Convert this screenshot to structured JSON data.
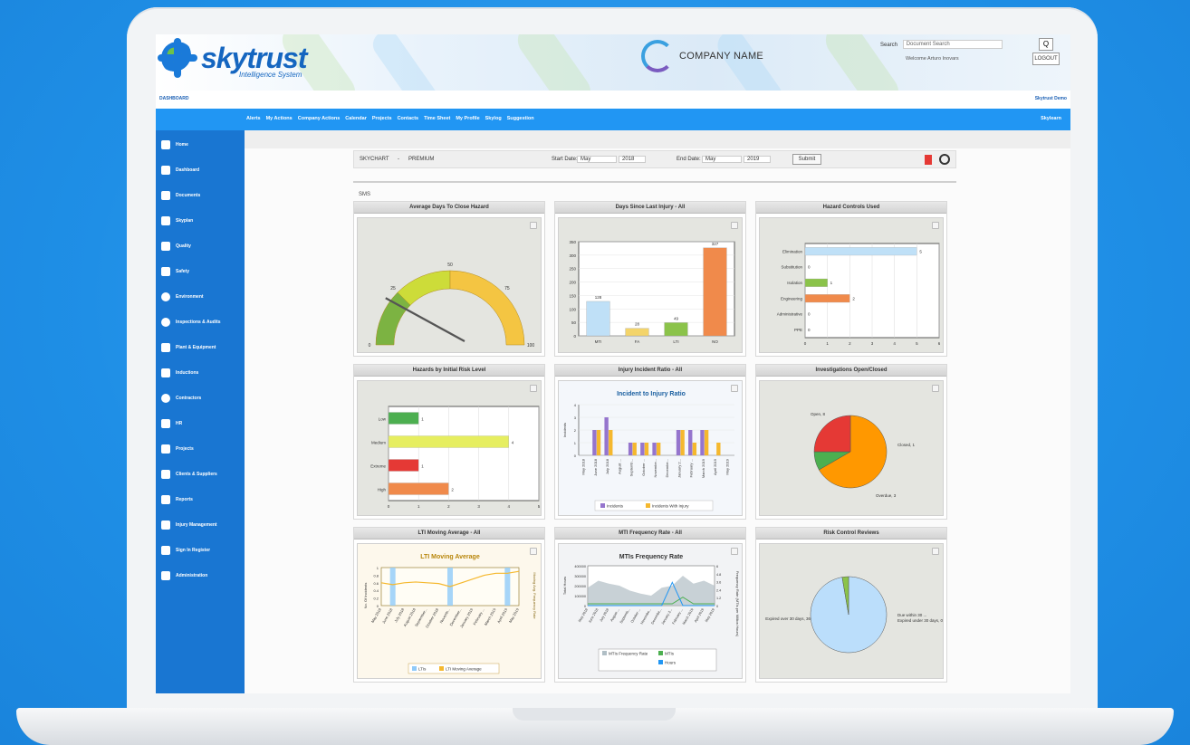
{
  "header": {
    "logo_text": "skytrust",
    "logo_subtitle": "Intelligence System",
    "company_name": "COMPANY NAME",
    "search_label": "Search",
    "search_placeholder": "Document Search",
    "welcome": "Welcome Arturo Inovars",
    "search_button": "Q",
    "logout": "LOGOUT"
  },
  "breadcrumb": {
    "left": "DASHBOARD",
    "right": "Skytrust Demo"
  },
  "nav": {
    "items": [
      "Alerts",
      "My Actions",
      "Company Actions",
      "Calendar",
      "Projects",
      "Contacts",
      "Time Sheet",
      "My Profile",
      "Skylog",
      "Suggestion"
    ],
    "right": "Skylearn"
  },
  "sidebar": {
    "items": [
      "Home",
      "Dashboard",
      "Documents",
      "Skyplan",
      "Quality",
      "Safety",
      "Environment",
      "Inspections & Audits",
      "Plant & Equipment",
      "Inductions",
      "Contractors",
      "HR",
      "Projects",
      "Clients & Suppliers",
      "Reports",
      "Injury Management",
      "Sign In Register",
      "Administration"
    ]
  },
  "toolbar": {
    "skychart": "SKYCHART",
    "sep": "-",
    "plan": "PREMIUM",
    "start_label": "Start Date:",
    "start_month": "May",
    "start_year": "2018",
    "end_label": "End Date:",
    "end_month": "May",
    "end_year": "2019",
    "submit": "Submit"
  },
  "section_label": "SMS",
  "colors": {
    "blue": "#2196f3",
    "sidebar": "#1976d2",
    "panel_bg": "#e4e5e0"
  },
  "chart_data": [
    {
      "id": "gauge",
      "title": "Average Days To Close Hazard",
      "type": "gauge",
      "min": 0,
      "max": 100,
      "ticks": [
        0,
        25,
        50,
        75,
        100
      ],
      "value": 20
    },
    {
      "id": "days-injury",
      "title": "Days Since Last Injury - All",
      "type": "bar",
      "categories": [
        "MTI",
        "FA",
        "LTI",
        "NO"
      ],
      "values": [
        128,
        28,
        49,
        327
      ],
      "colors": [
        "#bfe0f7",
        "#f3d46a",
        "#8bc34a",
        "#f08a4b"
      ],
      "ylim": [
        0,
        350
      ],
      "yticks": [
        0,
        50,
        100,
        150,
        200,
        250,
        300,
        350
      ]
    },
    {
      "id": "hazard-controls",
      "title": "Hazard Controls Used",
      "type": "bar",
      "orientation": "horizontal",
      "categories": [
        "Elimination",
        "Substitution",
        "Isolation",
        "Engineering",
        "Administrative",
        "PPE"
      ],
      "values": [
        5,
        0,
        1,
        2,
        0,
        0
      ],
      "colors": [
        "#bfe0f7",
        "#bfe0f7",
        "#8bc34a",
        "#f08a4b",
        "#bfe0f7",
        "#bfe0f7"
      ],
      "xlim": [
        0,
        6
      ],
      "xticks": [
        0,
        1,
        2,
        3,
        4,
        5,
        6
      ]
    },
    {
      "id": "risk-level",
      "title": "Hazards by Initial Risk Level",
      "type": "bar",
      "orientation": "horizontal",
      "categories": [
        "Low",
        "Medium",
        "Extreme",
        "High"
      ],
      "values": [
        1,
        4,
        1,
        2
      ],
      "colors": [
        "#4caf50",
        "#e6ee60",
        "#e53935",
        "#f08a4b"
      ],
      "xlim": [
        0,
        5
      ],
      "xticks": [
        0,
        1,
        2,
        3,
        4,
        5
      ]
    },
    {
      "id": "injury-ratio",
      "title": "Injury Incident Ratio - All",
      "chart_title": "Incident to Injury Ratio",
      "type": "bar",
      "categories": [
        "May 2018",
        "June 2018",
        "July 2018",
        "August ...",
        "Septemb...",
        "October ...",
        "Novembe...",
        "Decembe...",
        "January 2...",
        "February ...",
        "March 2019",
        "April 2019",
        "May 2019"
      ],
      "series": [
        {
          "name": "Incidents",
          "values": [
            0,
            2,
            3,
            0,
            1,
            1,
            1,
            0,
            2,
            2,
            2,
            0,
            0
          ],
          "color": "#9575cd"
        },
        {
          "name": "Incidents With Injury",
          "values": [
            0,
            2,
            2,
            0,
            1,
            1,
            1,
            0,
            2,
            1,
            2,
            1,
            0
          ],
          "color": "#f5b82e"
        }
      ],
      "ylabel": "Incidents",
      "ylim": [
        0,
        4
      ],
      "yticks": [
        0,
        1,
        2,
        3,
        4
      ]
    },
    {
      "id": "investigations",
      "title": "Investigations Open/Closed",
      "type": "pie",
      "slices": [
        {
          "label": "Open, 8",
          "value": 8,
          "color": "#ff9800"
        },
        {
          "label": "Closed, 1",
          "value": 1,
          "color": "#4caf50"
        },
        {
          "label": "Overdue, 3",
          "value": 3,
          "color": "#e53935"
        }
      ]
    },
    {
      "id": "lti-moving",
      "title": "LTI Moving Average - All",
      "chart_title": "LTI Moving Average",
      "type": "line",
      "categories": [
        "May 2018",
        "June 2018",
        "July 2018",
        "August 2018",
        "September...",
        "October 2018",
        "Novemb...",
        "December...",
        "January 2019",
        "February ...",
        "March 2019",
        "April 2019",
        "May 2019"
      ],
      "series": [
        {
          "name": "LTIs",
          "values": [
            0,
            1,
            0,
            0,
            0,
            0,
            1,
            0,
            0,
            0,
            0,
            1,
            0
          ],
          "color": "#90caf9"
        },
        {
          "name": "LTI Moving Average",
          "values": [
            0.6,
            0.55,
            0.6,
            0.62,
            0.6,
            0.58,
            0.5,
            0.6,
            0.7,
            0.8,
            0.85,
            0.85,
            0.9
          ],
          "color": "#f5b82e"
        }
      ],
      "ylabel": "No. Of Incidents",
      "y2label": "Moving Avg. Frequency Rate",
      "ylim": [
        0,
        1
      ],
      "yticks": [
        "0",
        "0.2",
        "0.4",
        "0.6",
        "0.8",
        "1"
      ]
    },
    {
      "id": "mti-frequency",
      "title": "MTI Frequency Rate - All",
      "chart_title": "MTIs Frequency Rate",
      "type": "area",
      "categories": [
        "May 2018",
        "June 2018",
        "July 2018",
        "August ...",
        "Septemb...",
        "October ...",
        "Novembe...",
        "Decembe...",
        "January 2...",
        "February ...",
        "March 2019",
        "April 2019",
        "May 2019"
      ],
      "series": [
        {
          "name": "MTIs Frequency Rate",
          "values": [
            180000,
            250000,
            220000,
            200000,
            150000,
            120000,
            100000,
            180000,
            200000,
            300000,
            220000,
            250000,
            200000
          ],
          "color": "#b0bec5"
        },
        {
          "name": "MTIs",
          "values": [
            0,
            0,
            0,
            0,
            0,
            0,
            0,
            0,
            0,
            1,
            0,
            0,
            0
          ],
          "color": "#4caf50"
        },
        {
          "name": "Hours",
          "values": [
            0,
            0,
            0,
            0,
            0,
            0,
            0,
            0,
            3.5,
            0,
            0,
            0,
            0
          ],
          "color": "#2196f3"
        }
      ],
      "ylabel": "Total Hours",
      "y2label": "Frequency Rate (MTIs per Million Hours)",
      "yticks": [
        "0",
        "100000",
        "200000",
        "300000",
        "400000"
      ],
      "y2ticks": [
        "0",
        "1.2",
        "2.4",
        "3.6",
        "4.8",
        "6"
      ]
    },
    {
      "id": "risk-control",
      "title": "Risk Control Reviews",
      "type": "pie",
      "slices": [
        {
          "label": "Expired over 30 days, 36",
          "value": 36,
          "color": "#bbdefb"
        },
        {
          "label": "Due within 30 ...",
          "value": 1,
          "color": "#8bc34a"
        },
        {
          "label": "Expired under 30 days, 0",
          "value": 0,
          "color": "#f5b82e"
        }
      ]
    }
  ]
}
